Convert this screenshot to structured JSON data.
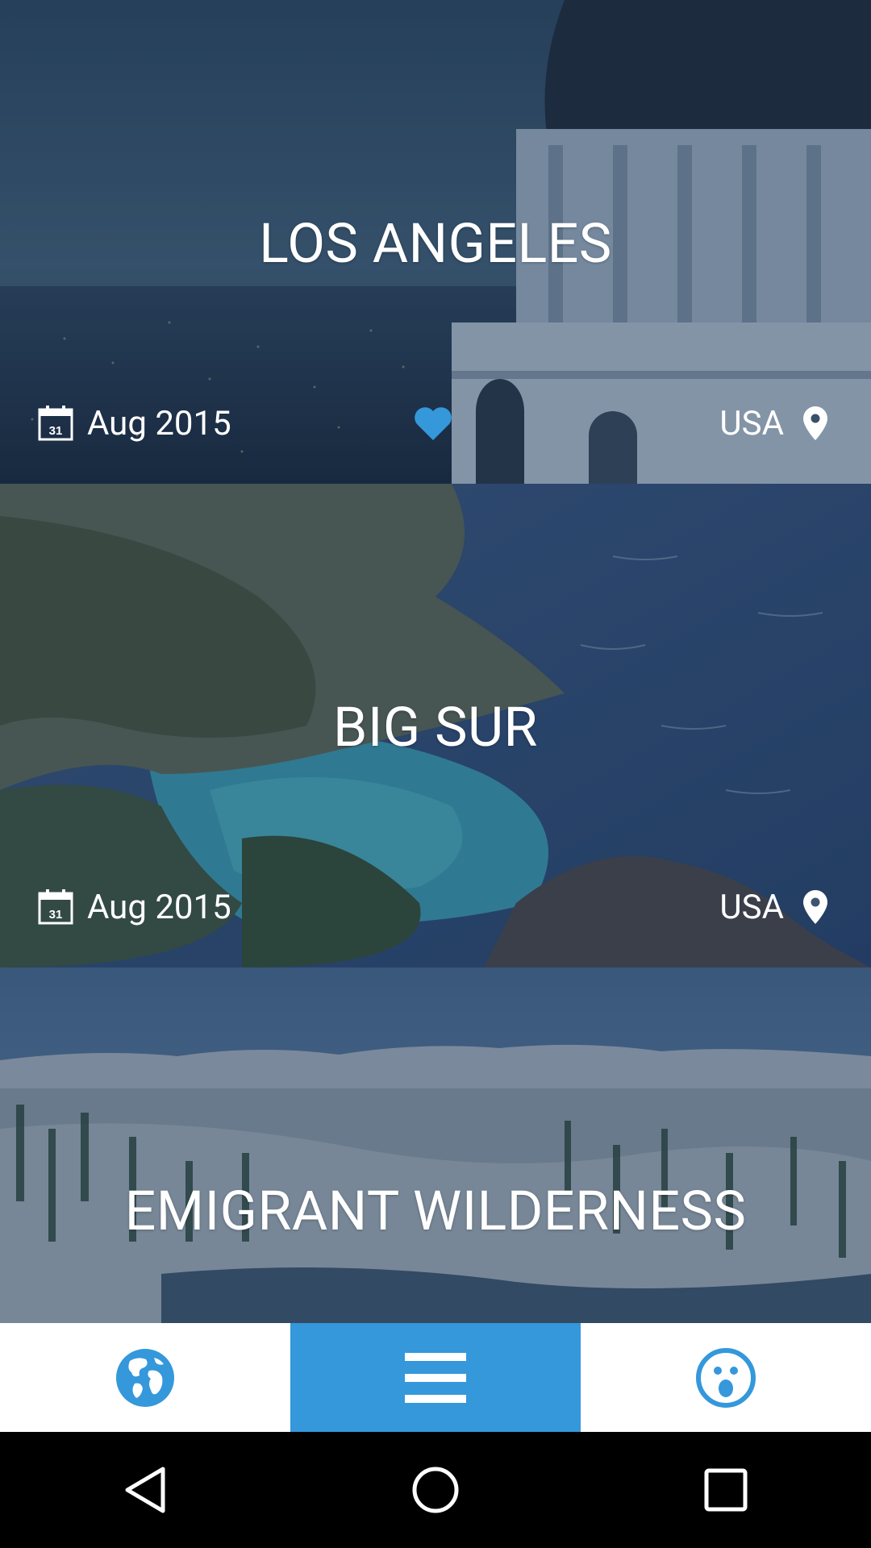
{
  "colors": {
    "accent": "#3498DB",
    "nav_background": "#FFFFFF",
    "system_bar": "#000000"
  },
  "trips": [
    {
      "title": "LOS ANGELES",
      "date": "Aug 2015",
      "country": "USA",
      "favorited": true,
      "image": "los-angeles-observatory-photo"
    },
    {
      "title": "BIG SUR",
      "date": "Aug 2015",
      "country": "USA",
      "favorited": false,
      "image": "big-sur-coastline-photo"
    },
    {
      "title": "EMIGRANT WILDERNESS",
      "image": "emigrant-wilderness-mountains-photo"
    }
  ],
  "bottom_nav": {
    "items": [
      {
        "icon": "globe-icon",
        "active": false
      },
      {
        "icon": "list-menu-icon",
        "active": true
      },
      {
        "icon": "surprised-face-icon",
        "active": false
      }
    ]
  },
  "system_nav": {
    "items": [
      "back-icon",
      "home-icon",
      "recents-icon"
    ]
  }
}
